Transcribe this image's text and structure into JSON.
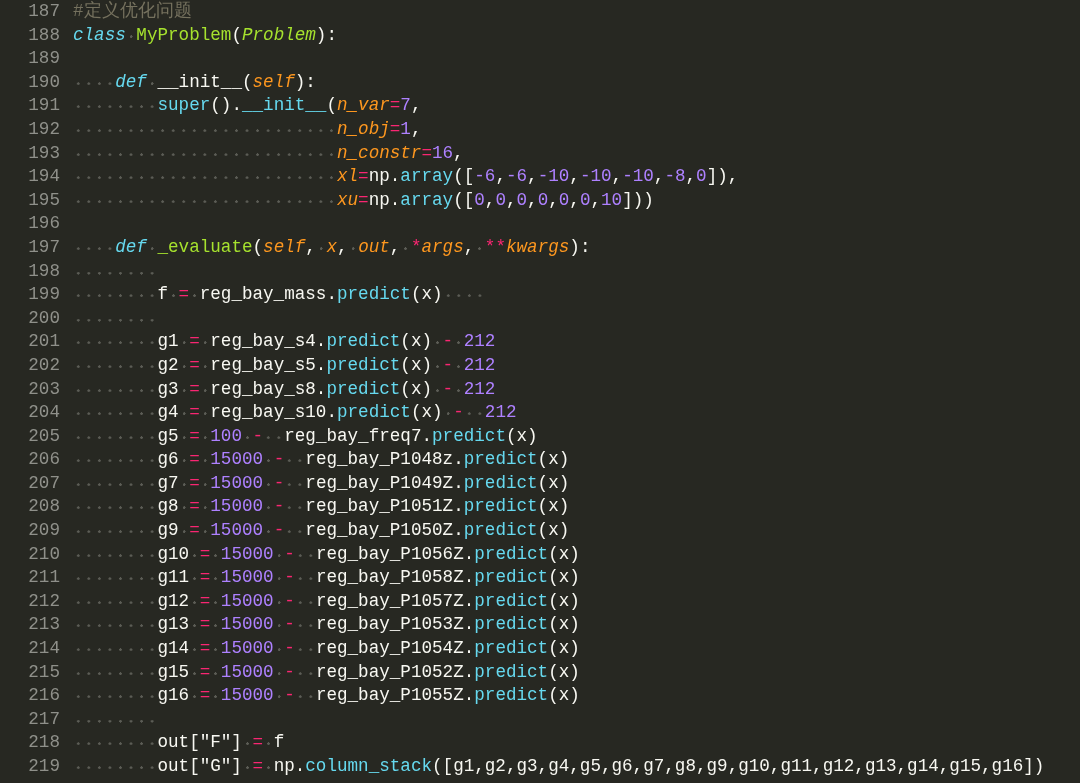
{
  "editor": {
    "lines": [
      {
        "number": "187",
        "tokens": [
          {
            "kind": "comment",
            "text": "#定义优化问题"
          }
        ]
      },
      {
        "number": "188",
        "tokens": [
          {
            "kind": "kw",
            "text": "class"
          },
          {
            "kind": "cls",
            "text": " MyProblem"
          },
          {
            "kind": "plain",
            "text": "("
          },
          {
            "kind": "inh",
            "text": "Problem"
          },
          {
            "kind": "plain",
            "text": "):"
          }
        ]
      },
      {
        "number": "189"
      },
      {
        "number": "190",
        "tokens": [
          {
            "kind": "kw",
            "text": "    def"
          },
          {
            "kind": "plain",
            "text": " __init__("
          },
          {
            "kind": "param",
            "text": "self"
          },
          {
            "kind": "plain",
            "text": "):"
          }
        ]
      },
      {
        "number": "191",
        "tokens": [
          {
            "kind": "call",
            "text": "        super"
          },
          {
            "kind": "plain",
            "text": "()."
          },
          {
            "kind": "call",
            "text": "__init__"
          },
          {
            "kind": "plain",
            "text": "("
          },
          {
            "kind": "param",
            "text": "n_var"
          },
          {
            "kind": "op",
            "text": "="
          },
          {
            "kind": "num",
            "text": "7"
          },
          {
            "kind": "plain",
            "text": ","
          }
        ]
      },
      {
        "number": "192",
        "tokens": [
          {
            "kind": "param",
            "text": "                         n_obj"
          },
          {
            "kind": "op",
            "text": "="
          },
          {
            "kind": "num",
            "text": "1"
          },
          {
            "kind": "plain",
            "text": ","
          }
        ]
      },
      {
        "number": "193",
        "tokens": [
          {
            "kind": "param",
            "text": "                         n_constr"
          },
          {
            "kind": "op",
            "text": "="
          },
          {
            "kind": "num",
            "text": "16"
          },
          {
            "kind": "plain",
            "text": ","
          }
        ]
      },
      {
        "number": "194",
        "tokens": [
          {
            "kind": "param",
            "text": "                         xl"
          },
          {
            "kind": "op",
            "text": "="
          },
          {
            "kind": "plain",
            "text": "np."
          },
          {
            "kind": "call",
            "text": "array"
          },
          {
            "kind": "plain",
            "text": "(["
          },
          {
            "kind": "num",
            "text": "-6"
          },
          {
            "kind": "plain",
            "text": ","
          },
          {
            "kind": "num",
            "text": "-6"
          },
          {
            "kind": "plain",
            "text": ","
          },
          {
            "kind": "num",
            "text": "-10"
          },
          {
            "kind": "plain",
            "text": ","
          },
          {
            "kind": "num",
            "text": "-10"
          },
          {
            "kind": "plain",
            "text": ","
          },
          {
            "kind": "num",
            "text": "-10"
          },
          {
            "kind": "plain",
            "text": ","
          },
          {
            "kind": "num",
            "text": "-8"
          },
          {
            "kind": "plain",
            "text": ","
          },
          {
            "kind": "num",
            "text": "0"
          },
          {
            "kind": "plain",
            "text": "]),"
          }
        ]
      },
      {
        "number": "195",
        "tokens": [
          {
            "kind": "param",
            "text": "                         xu"
          },
          {
            "kind": "op",
            "text": "="
          },
          {
            "kind": "plain",
            "text": "np."
          },
          {
            "kind": "call",
            "text": "array"
          },
          {
            "kind": "plain",
            "text": "(["
          },
          {
            "kind": "num",
            "text": "0"
          },
          {
            "kind": "plain",
            "text": ","
          },
          {
            "kind": "num",
            "text": "0"
          },
          {
            "kind": "plain",
            "text": ","
          },
          {
            "kind": "num",
            "text": "0"
          },
          {
            "kind": "plain",
            "text": ","
          },
          {
            "kind": "num",
            "text": "0"
          },
          {
            "kind": "plain",
            "text": ","
          },
          {
            "kind": "num",
            "text": "0"
          },
          {
            "kind": "plain",
            "text": ","
          },
          {
            "kind": "num",
            "text": "0"
          },
          {
            "kind": "plain",
            "text": ","
          },
          {
            "kind": "num",
            "text": "10"
          },
          {
            "kind": "plain",
            "text": "]))"
          }
        ]
      },
      {
        "number": "196"
      },
      {
        "number": "197",
        "tokens": [
          {
            "kind": "kw",
            "text": "    def"
          },
          {
            "kind": "fn",
            "text": " _evaluate"
          },
          {
            "kind": "plain",
            "text": "("
          },
          {
            "kind": "param",
            "text": "self"
          },
          {
            "kind": "plain",
            "text": ", "
          },
          {
            "kind": "param",
            "text": "x"
          },
          {
            "kind": "plain",
            "text": ", "
          },
          {
            "kind": "param",
            "text": "out"
          },
          {
            "kind": "plain",
            "text": ", "
          },
          {
            "kind": "op",
            "text": "*"
          },
          {
            "kind": "param",
            "text": "args"
          },
          {
            "kind": "plain",
            "text": ", "
          },
          {
            "kind": "op",
            "text": "**"
          },
          {
            "kind": "param",
            "text": "kwargs"
          },
          {
            "kind": "plain",
            "text": "):"
          }
        ]
      },
      {
        "number": "198",
        "indented": true
      },
      {
        "number": "199",
        "tokens": [
          {
            "kind": "plain",
            "text": "        f "
          },
          {
            "kind": "op",
            "text": "="
          },
          {
            "kind": "plain",
            "text": " reg_bay_mass."
          },
          {
            "kind": "call",
            "text": "predict"
          },
          {
            "kind": "plain",
            "text": "(x)    "
          }
        ]
      },
      {
        "number": "200",
        "indented": true
      },
      {
        "number": "201",
        "tokens": [
          {
            "kind": "plain",
            "text": "        g1 "
          },
          {
            "kind": "op",
            "text": "="
          },
          {
            "kind": "plain",
            "text": " reg_bay_s4."
          },
          {
            "kind": "call",
            "text": "predict"
          },
          {
            "kind": "plain",
            "text": "(x) "
          },
          {
            "kind": "op",
            "text": "-"
          },
          {
            "kind": "num",
            "text": " 212"
          }
        ]
      },
      {
        "number": "202",
        "tokens": [
          {
            "kind": "plain",
            "text": "        g2 "
          },
          {
            "kind": "op",
            "text": "="
          },
          {
            "kind": "plain",
            "text": " reg_bay_s5."
          },
          {
            "kind": "call",
            "text": "predict"
          },
          {
            "kind": "plain",
            "text": "(x) "
          },
          {
            "kind": "op",
            "text": "-"
          },
          {
            "kind": "num",
            "text": " 212"
          }
        ]
      },
      {
        "number": "203",
        "tokens": [
          {
            "kind": "plain",
            "text": "        g3 "
          },
          {
            "kind": "op",
            "text": "="
          },
          {
            "kind": "plain",
            "text": " reg_bay_s8."
          },
          {
            "kind": "call",
            "text": "predict"
          },
          {
            "kind": "plain",
            "text": "(x) "
          },
          {
            "kind": "op",
            "text": "-"
          },
          {
            "kind": "num",
            "text": " 212"
          }
        ]
      },
      {
        "number": "204",
        "tokens": [
          {
            "kind": "plain",
            "text": "        g4 "
          },
          {
            "kind": "op",
            "text": "="
          },
          {
            "kind": "plain",
            "text": " reg_bay_s10."
          },
          {
            "kind": "call",
            "text": "predict"
          },
          {
            "kind": "plain",
            "text": "(x) "
          },
          {
            "kind": "op",
            "text": "-"
          },
          {
            "kind": "num",
            "text": "  212"
          }
        ]
      },
      {
        "number": "205",
        "tokens": [
          {
            "kind": "plain",
            "text": "        g5 "
          },
          {
            "kind": "op",
            "text": "="
          },
          {
            "kind": "num",
            "text": " 100 "
          },
          {
            "kind": "op",
            "text": "-"
          },
          {
            "kind": "plain",
            "text": "  reg_bay_freq7."
          },
          {
            "kind": "call",
            "text": "predict"
          },
          {
            "kind": "plain",
            "text": "(x)"
          }
        ]
      },
      {
        "number": "206",
        "tokens": [
          {
            "kind": "plain",
            "text": "        g6 "
          },
          {
            "kind": "op",
            "text": "="
          },
          {
            "kind": "num",
            "text": " 15000 "
          },
          {
            "kind": "op",
            "text": "-"
          },
          {
            "kind": "plain",
            "text": "  reg_bay_P1048z."
          },
          {
            "kind": "call",
            "text": "predict"
          },
          {
            "kind": "plain",
            "text": "(x)"
          }
        ]
      },
      {
        "number": "207",
        "tokens": [
          {
            "kind": "plain",
            "text": "        g7 "
          },
          {
            "kind": "op",
            "text": "="
          },
          {
            "kind": "num",
            "text": " 15000 "
          },
          {
            "kind": "op",
            "text": "-"
          },
          {
            "kind": "plain",
            "text": "  reg_bay_P1049Z."
          },
          {
            "kind": "call",
            "text": "predict"
          },
          {
            "kind": "plain",
            "text": "(x)"
          }
        ]
      },
      {
        "number": "208",
        "tokens": [
          {
            "kind": "plain",
            "text": "        g8 "
          },
          {
            "kind": "op",
            "text": "="
          },
          {
            "kind": "num",
            "text": " 15000 "
          },
          {
            "kind": "op",
            "text": "-"
          },
          {
            "kind": "plain",
            "text": "  reg_bay_P1051Z."
          },
          {
            "kind": "call",
            "text": "predict"
          },
          {
            "kind": "plain",
            "text": "(x)"
          }
        ]
      },
      {
        "number": "209",
        "tokens": [
          {
            "kind": "plain",
            "text": "        g9 "
          },
          {
            "kind": "op",
            "text": "="
          },
          {
            "kind": "num",
            "text": " 15000 "
          },
          {
            "kind": "op",
            "text": "-"
          },
          {
            "kind": "plain",
            "text": "  reg_bay_P1050Z."
          },
          {
            "kind": "call",
            "text": "predict"
          },
          {
            "kind": "plain",
            "text": "(x)"
          }
        ]
      },
      {
        "number": "210",
        "tokens": [
          {
            "kind": "plain",
            "text": "        g10 "
          },
          {
            "kind": "op",
            "text": "="
          },
          {
            "kind": "num",
            "text": " 15000 "
          },
          {
            "kind": "op",
            "text": "-"
          },
          {
            "kind": "plain",
            "text": "  reg_bay_P1056Z."
          },
          {
            "kind": "call",
            "text": "predict"
          },
          {
            "kind": "plain",
            "text": "(x)"
          }
        ]
      },
      {
        "number": "211",
        "tokens": [
          {
            "kind": "plain",
            "text": "        g11 "
          },
          {
            "kind": "op",
            "text": "="
          },
          {
            "kind": "num",
            "text": " 15000 "
          },
          {
            "kind": "op",
            "text": "-"
          },
          {
            "kind": "plain",
            "text": "  reg_bay_P1058Z."
          },
          {
            "kind": "call",
            "text": "predict"
          },
          {
            "kind": "plain",
            "text": "(x)"
          }
        ]
      },
      {
        "number": "212",
        "tokens": [
          {
            "kind": "plain",
            "text": "        g12 "
          },
          {
            "kind": "op",
            "text": "="
          },
          {
            "kind": "num",
            "text": " 15000 "
          },
          {
            "kind": "op",
            "text": "-"
          },
          {
            "kind": "plain",
            "text": "  reg_bay_P1057Z."
          },
          {
            "kind": "call",
            "text": "predict"
          },
          {
            "kind": "plain",
            "text": "(x)"
          }
        ]
      },
      {
        "number": "213",
        "tokens": [
          {
            "kind": "plain",
            "text": "        g13 "
          },
          {
            "kind": "op",
            "text": "="
          },
          {
            "kind": "num",
            "text": " 15000 "
          },
          {
            "kind": "op",
            "text": "-"
          },
          {
            "kind": "plain",
            "text": "  reg_bay_P1053Z."
          },
          {
            "kind": "call",
            "text": "predict"
          },
          {
            "kind": "plain",
            "text": "(x)"
          }
        ]
      },
      {
        "number": "214",
        "tokens": [
          {
            "kind": "plain",
            "text": "        g14 "
          },
          {
            "kind": "op",
            "text": "="
          },
          {
            "kind": "num",
            "text": " 15000 "
          },
          {
            "kind": "op",
            "text": "-"
          },
          {
            "kind": "plain",
            "text": "  reg_bay_P1054Z."
          },
          {
            "kind": "call",
            "text": "predict"
          },
          {
            "kind": "plain",
            "text": "(x)"
          }
        ]
      },
      {
        "number": "215",
        "tokens": [
          {
            "kind": "plain",
            "text": "        g15 "
          },
          {
            "kind": "op",
            "text": "="
          },
          {
            "kind": "num",
            "text": " 15000 "
          },
          {
            "kind": "op",
            "text": "-"
          },
          {
            "kind": "plain",
            "text": "  reg_bay_P1052Z."
          },
          {
            "kind": "call",
            "text": "predict"
          },
          {
            "kind": "plain",
            "text": "(x)"
          }
        ]
      },
      {
        "number": "216",
        "tokens": [
          {
            "kind": "plain",
            "text": "        g16 "
          },
          {
            "kind": "op",
            "text": "="
          },
          {
            "kind": "num",
            "text": " 15000 "
          },
          {
            "kind": "op",
            "text": "-"
          },
          {
            "kind": "plain",
            "text": "  reg_bay_P1055Z."
          },
          {
            "kind": "call",
            "text": "predict"
          },
          {
            "kind": "plain",
            "text": "(x)"
          }
        ]
      },
      {
        "number": "217",
        "indented": true
      },
      {
        "number": "218",
        "tokens": [
          {
            "kind": "plain",
            "text": "        out[\"F\"] "
          },
          {
            "kind": "op",
            "text": "="
          },
          {
            "kind": "plain",
            "text": " f"
          }
        ]
      },
      {
        "number": "219",
        "tokens": [
          {
            "kind": "plain",
            "text": "        out[\"G\"] "
          },
          {
            "kind": "op",
            "text": "="
          },
          {
            "kind": "plain",
            "text": " np."
          },
          {
            "kind": "call",
            "text": "column_stack"
          },
          {
            "kind": "plain",
            "text": "([g1,g2,g3,g4,g5,g6,g7,g8,g9,g10,g11,g12,g13,g14,g15,g16])"
          }
        ]
      }
    ]
  }
}
